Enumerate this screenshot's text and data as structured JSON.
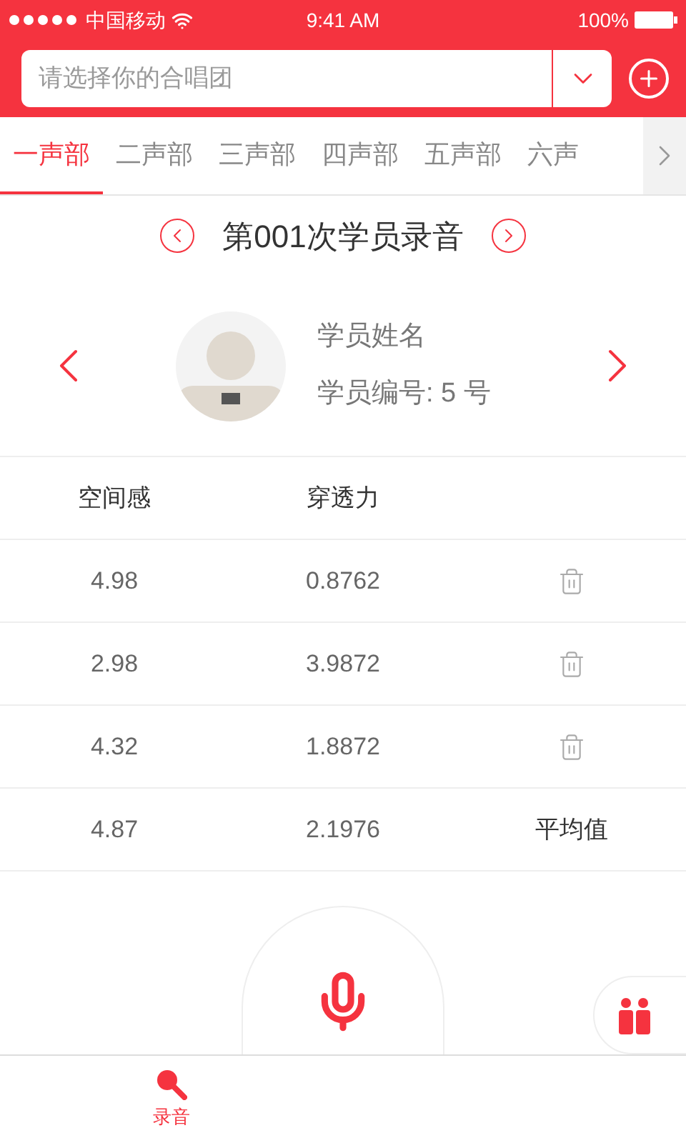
{
  "status_bar": {
    "carrier": "中国移动",
    "time": "9:41 AM",
    "battery": "100%"
  },
  "search": {
    "placeholder": "请选择你的合唱团"
  },
  "tabs": [
    {
      "label": "一声部",
      "selected": true
    },
    {
      "label": "二声部",
      "selected": false
    },
    {
      "label": "三声部",
      "selected": false
    },
    {
      "label": "四声部",
      "selected": false
    },
    {
      "label": "五声部",
      "selected": false
    },
    {
      "label": "六声",
      "selected": false
    }
  ],
  "recording_title": "第001次学员录音",
  "student": {
    "name": "学员姓名",
    "number": "学员编号: 5 号"
  },
  "table": {
    "columns": [
      "空间感",
      "穿透力"
    ],
    "rows": [
      {
        "kind": "entry",
        "cells": [
          "4.98",
          "0.8762"
        ]
      },
      {
        "kind": "entry",
        "cells": [
          "2.98",
          "3.9872"
        ]
      },
      {
        "kind": "entry",
        "cells": [
          "4.32",
          "1.8872"
        ]
      },
      {
        "kind": "average",
        "cells": [
          "4.87",
          "2.1976"
        ],
        "label": "平均值"
      }
    ]
  },
  "bottom_tabs": [
    {
      "label": "录音",
      "selected": true
    }
  ]
}
